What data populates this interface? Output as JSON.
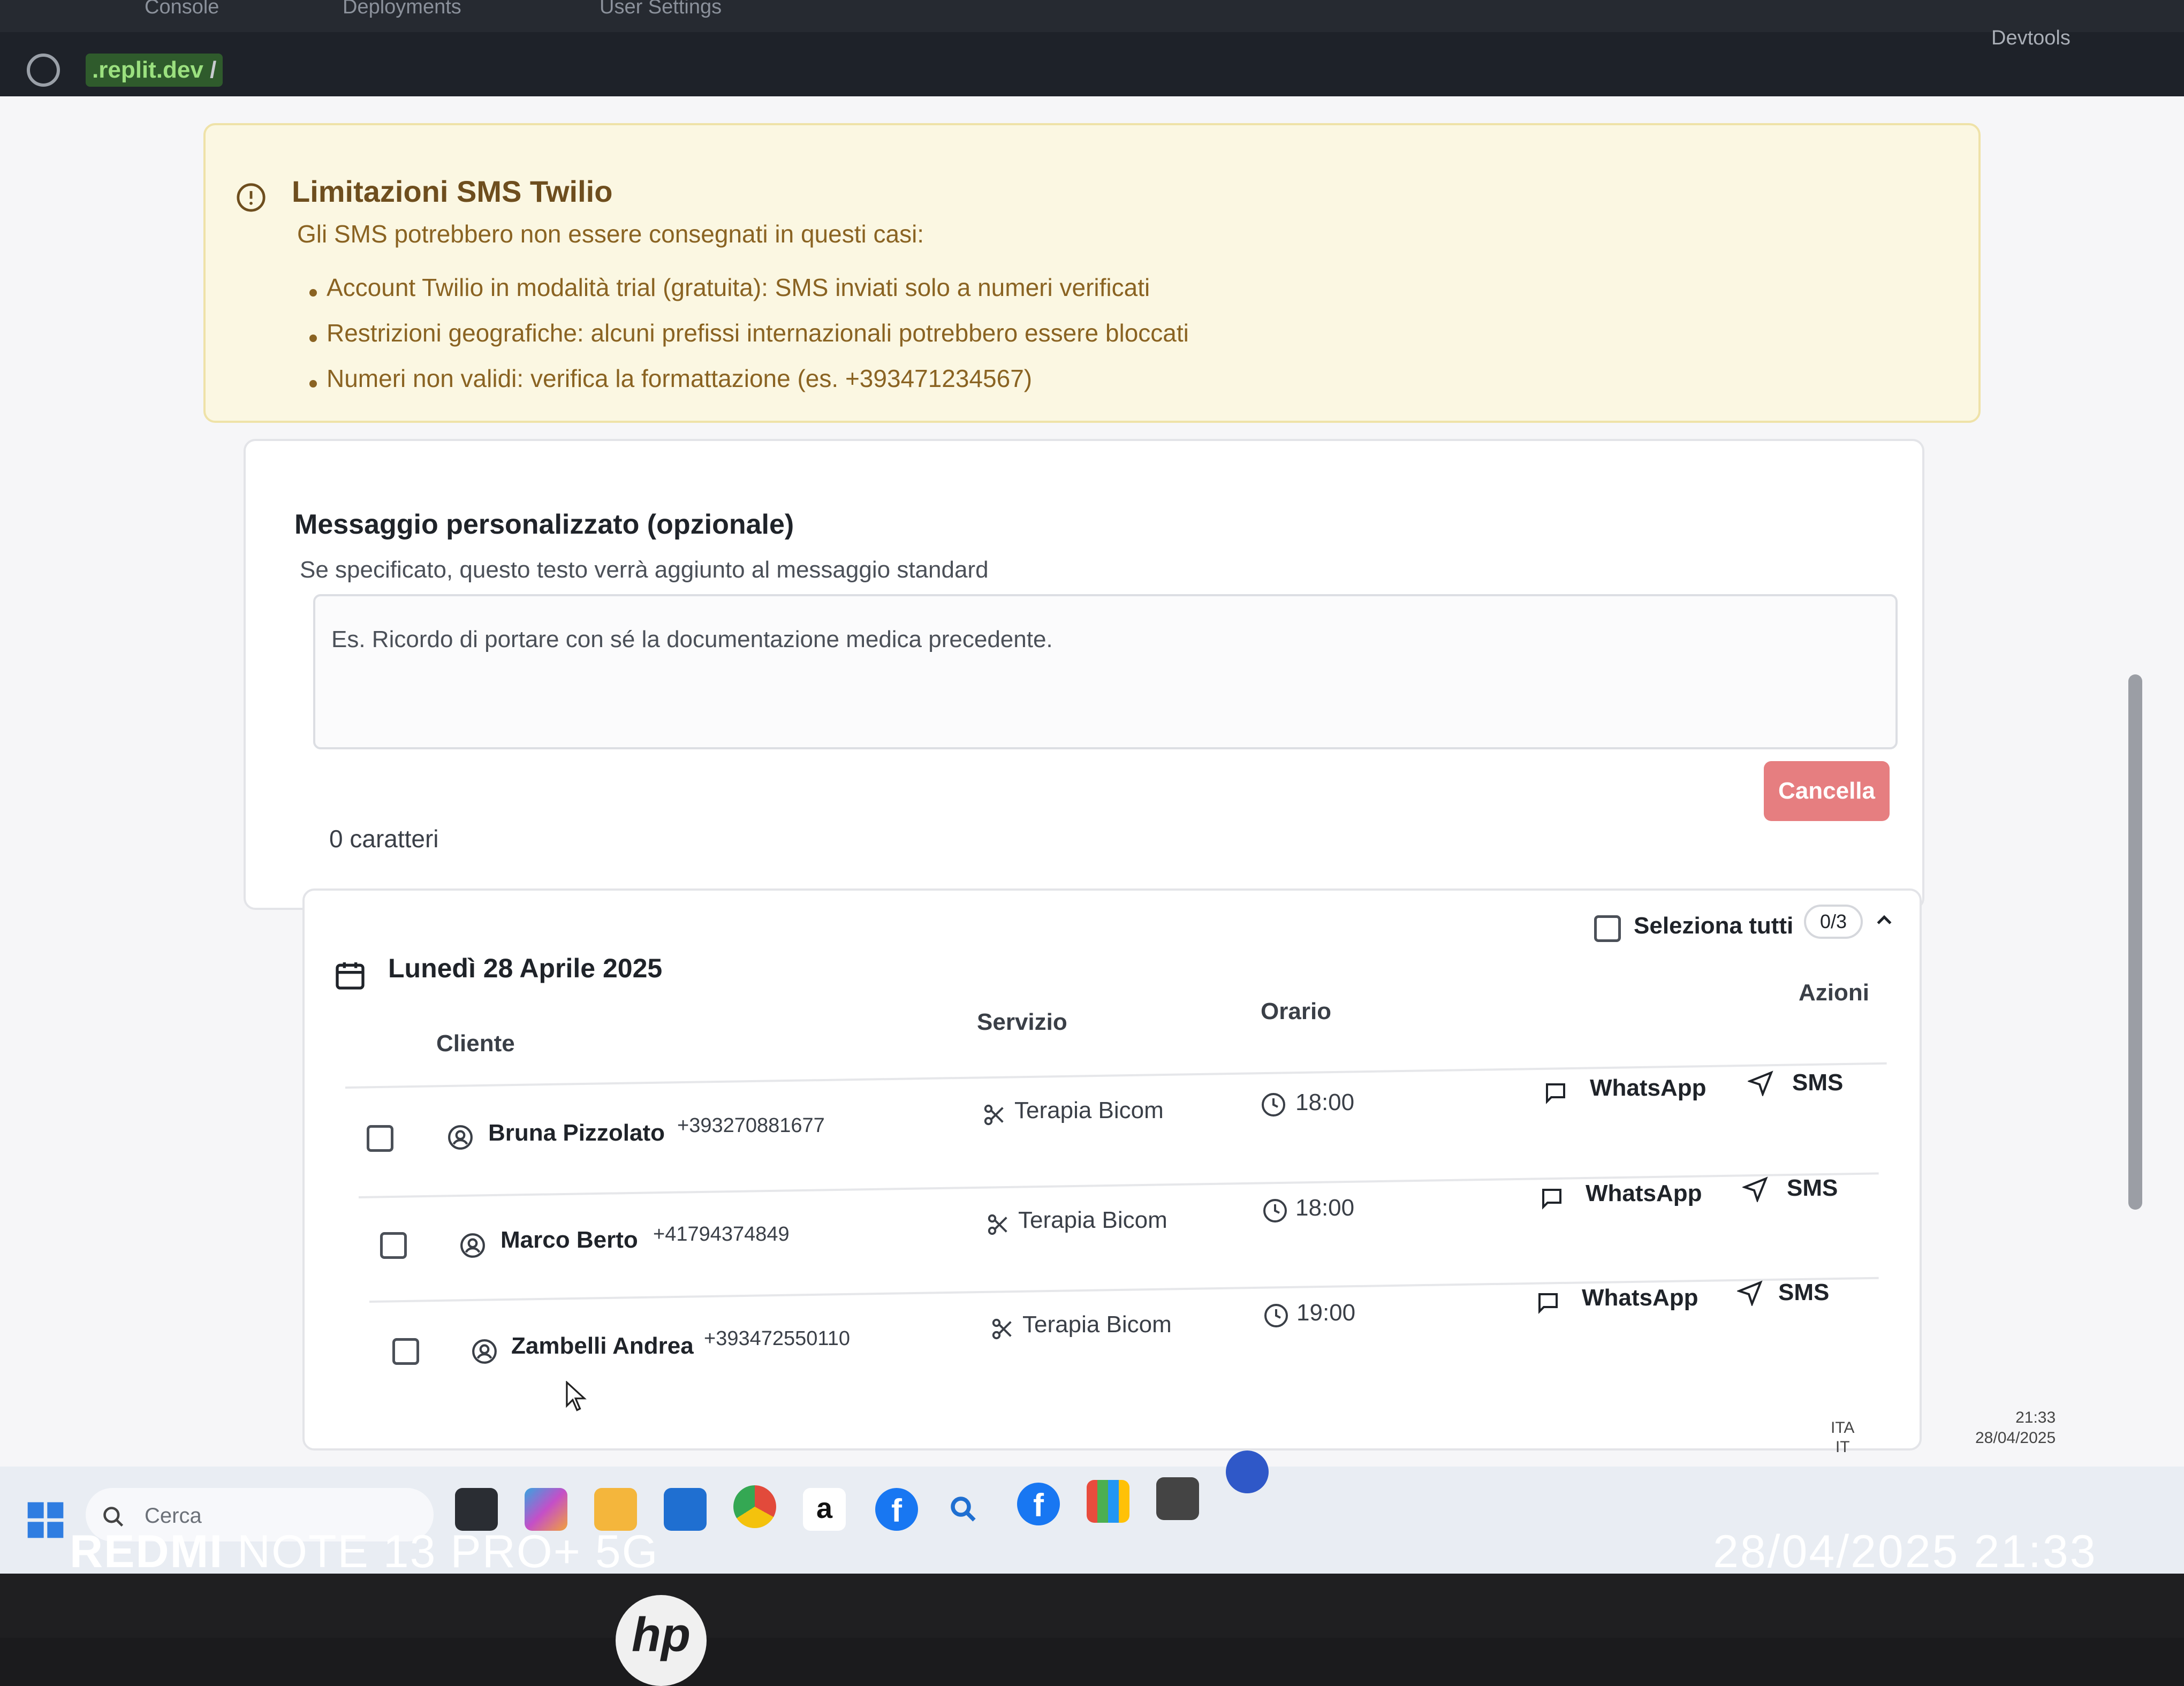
{
  "browser": {
    "tabs": [
      "Console",
      "Deployments",
      "User Settings"
    ],
    "url_domain": ".replit.dev",
    "url_path": "/",
    "devtools_label": "Devtools"
  },
  "warning": {
    "title": "Limitazioni SMS Twilio",
    "subtitle": "Gli SMS potrebbero non essere consegnati in questi casi:",
    "items": [
      "Account Twilio in modalità trial (gratuita): SMS inviati solo a numeri verificati",
      "Restrizioni geografiche: alcuni prefissi internazionali potrebbero essere bloccati",
      "Numeri non validi: verifica la formattazione (es. +393471234567)"
    ]
  },
  "message": {
    "title": "Messaggio personalizzato (opzionale)",
    "subtitle": "Se specificato, questo testo verrà aggiunto al messaggio standard",
    "placeholder": "Es. Ricordo di portare con sé la documentazione medica precedente.",
    "cancel_label": "Cancella",
    "char_count": "0 caratteri"
  },
  "appointments": {
    "date_title": "Lunedì 28 Aprile 2025",
    "select_all_label": "Seleziona tutti",
    "selected_count": "0/3",
    "columns": {
      "client": "Cliente",
      "service": "Servizio",
      "time": "Orario",
      "actions": "Azioni"
    },
    "rows": [
      {
        "name": "Bruna Pizzolato",
        "phone": "+393270881677",
        "service": "Terapia Bicom",
        "time": "18:00",
        "whatsapp": "WhatsApp",
        "sms": "SMS"
      },
      {
        "name": "Marco Berto",
        "phone": "+41794374849",
        "service": "Terapia Bicom",
        "time": "18:00",
        "whatsapp": "WhatsApp",
        "sms": "SMS"
      },
      {
        "name": "Zambelli Andrea",
        "phone": "+393472550110",
        "service": "Terapia Bicom",
        "time": "19:00",
        "whatsapp": "WhatsApp",
        "sms": "SMS"
      }
    ]
  },
  "taskbar": {
    "search_placeholder": "Cerca",
    "lang_primary": "ITA",
    "lang_secondary": "IT",
    "time": "21:33",
    "date": "28/04/2025",
    "icons": [
      "start-icon",
      "task-view-icon",
      "copilot-icon",
      "file-explorer-icon",
      "outlook-icon",
      "chrome-icon",
      "amazon-icon",
      "facebook-icon",
      "search-icon",
      "facebook-icon",
      "store-icon",
      "media-icon",
      "app-icon"
    ]
  },
  "photo_overlay": {
    "brand": "REDMI",
    "model": "NOTE 13 PRO+ 5G",
    "datetime": "28/04/2025 21:33",
    "laptop_logo": "hp"
  },
  "colors": {
    "warning_bg": "#fbf7e2",
    "warning_text": "#8a6322",
    "cancel_button": "#e67e80",
    "text_primary": "#1f2329"
  }
}
